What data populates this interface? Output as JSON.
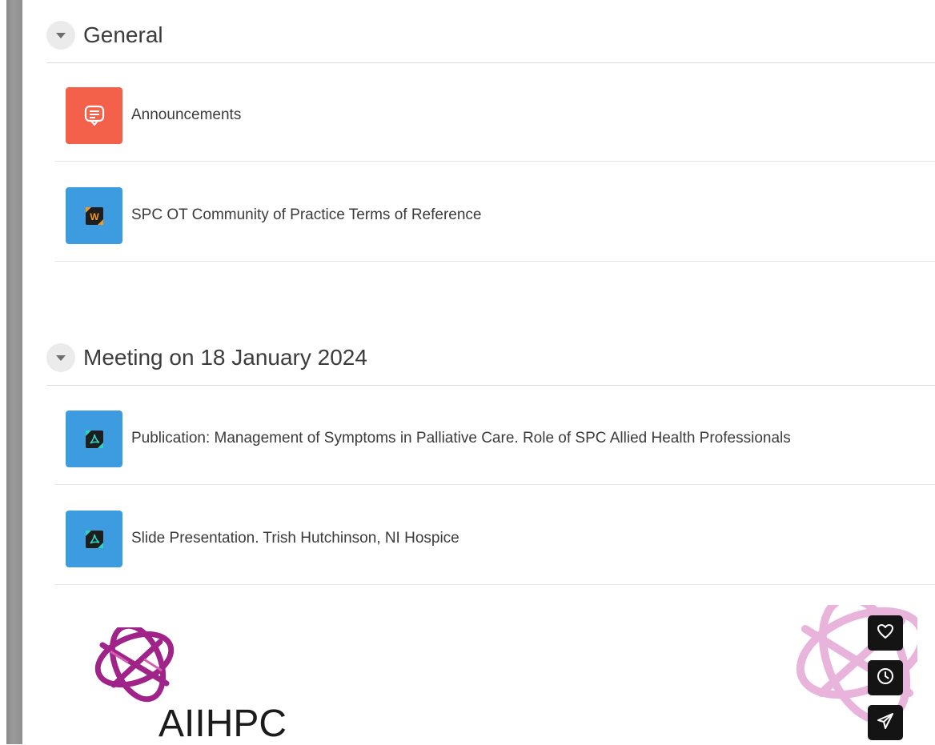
{
  "sections": [
    {
      "title": "General",
      "activities": [
        {
          "label": "Announcements",
          "icon": "forum-icon",
          "color": "#f4614a"
        },
        {
          "label": "SPC OT Community of Practice Terms of Reference",
          "icon": "word-document-icon",
          "color": "#3d9be0"
        }
      ]
    },
    {
      "title": "Meeting on 18 January 2024",
      "activities": [
        {
          "label": "Publication: Management of Symptoms in Palliative Care. Role of SPC Allied Health Professionals",
          "icon": "pdf-document-icon",
          "color": "#3d9be0"
        },
        {
          "label": "Slide Presentation. Trish Hutchinson, NI Hospice",
          "icon": "pdf-document-icon",
          "color": "#3d9be0"
        }
      ]
    }
  ],
  "footer": {
    "logo_text": "AIIHPC"
  },
  "floating_actions": [
    {
      "icon": "heart-icon"
    },
    {
      "icon": "clock-icon"
    },
    {
      "icon": "send-icon"
    }
  ]
}
